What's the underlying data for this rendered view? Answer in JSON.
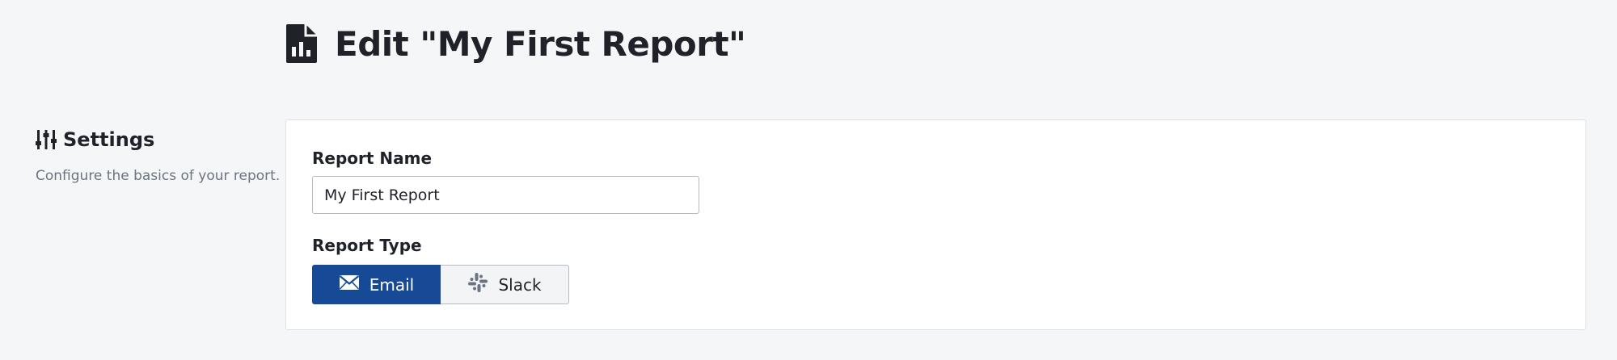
{
  "header": {
    "title": "Edit \"My First Report\"",
    "icon": "report-file-icon"
  },
  "section": {
    "title": "Settings",
    "icon": "sliders-icon",
    "description": "Configure the basics of your report."
  },
  "form": {
    "report_name_label": "Report Name",
    "report_name_value": "My First Report",
    "report_type_label": "Report Type",
    "report_types": [
      {
        "label": "Email",
        "icon": "envelope-icon",
        "selected": true
      },
      {
        "label": "Slack",
        "icon": "slack-icon",
        "selected": false
      }
    ]
  },
  "colors": {
    "accent": "#174a96",
    "background": "#f5f6f8",
    "card": "#ffffff",
    "muted_text": "#6b7480"
  }
}
